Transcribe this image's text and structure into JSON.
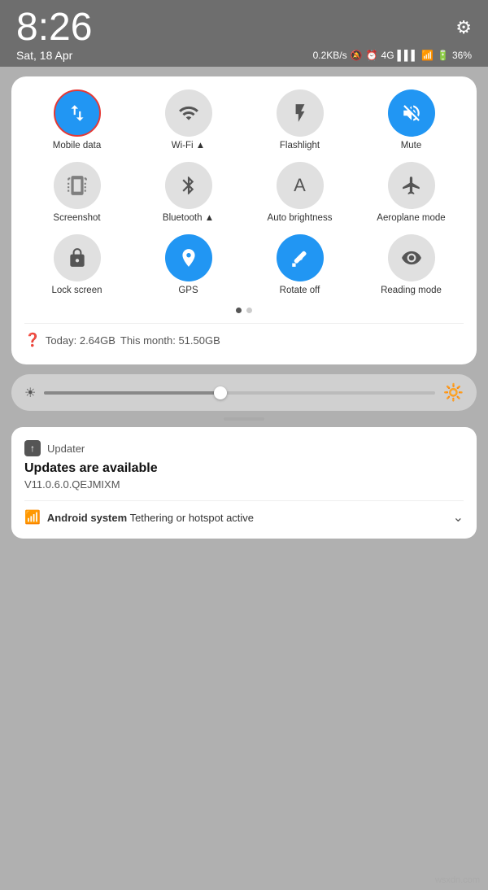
{
  "statusBar": {
    "time": "8:26",
    "date": "Sat, 18 Apr",
    "speed": "0.2KB/s",
    "battery": "36%"
  },
  "tiles": [
    {
      "id": "mobile-data",
      "label": "Mobile data",
      "active": true,
      "highlighted": true
    },
    {
      "id": "wifi",
      "label": "Wi-Fi",
      "active": false,
      "highlighted": false
    },
    {
      "id": "flashlight",
      "label": "Flashlight",
      "active": false,
      "highlighted": false
    },
    {
      "id": "mute",
      "label": "Mute",
      "active": true,
      "highlighted": false
    },
    {
      "id": "screenshot",
      "label": "Screenshot",
      "active": false,
      "highlighted": false
    },
    {
      "id": "bluetooth",
      "label": "Bluetooth",
      "active": false,
      "highlighted": false
    },
    {
      "id": "auto-brightness",
      "label": "Auto brightness",
      "active": false,
      "highlighted": false
    },
    {
      "id": "aeroplane",
      "label": "Aeroplane mode",
      "active": false,
      "highlighted": false
    },
    {
      "id": "lock-screen",
      "label": "Lock screen",
      "active": false,
      "highlighted": false
    },
    {
      "id": "gps",
      "label": "GPS",
      "active": true,
      "highlighted": false
    },
    {
      "id": "rotate-off",
      "label": "Rotate off",
      "active": true,
      "highlighted": false
    },
    {
      "id": "reading-mode",
      "label": "Reading mode",
      "active": false,
      "highlighted": false
    }
  ],
  "dataUsage": {
    "today": "Today: 2.64GB",
    "month": "This month: 51.50GB"
  },
  "notification": {
    "appName": "Updater",
    "title": "Updates are available",
    "subtitle": "V11.0.6.0.QEJMIXM",
    "androidLabel": "Android system",
    "androidDesc": "Tethering or hotspot active"
  },
  "watermark": "wsxdn.com"
}
